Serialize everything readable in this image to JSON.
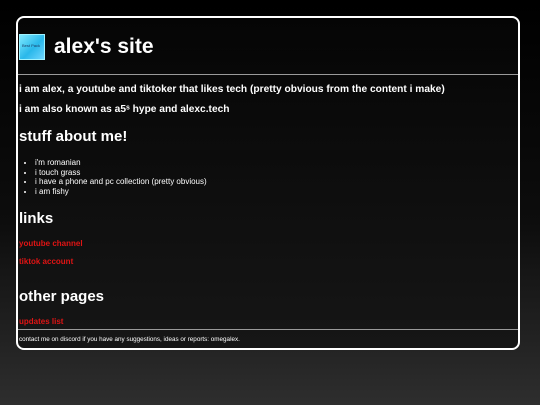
{
  "header": {
    "logo_text": "Best Pack",
    "title": "alex's site"
  },
  "intro": {
    "line1": "i am alex, a youtube and tiktoker that likes tech (pretty obvious from the content i make)",
    "line2": "i am also known as a5ˢ hype and alexc.tech"
  },
  "about": {
    "heading": "stuff about me!",
    "items": [
      "i'm romanian",
      "i touch grass",
      "i have a phone and pc collection (pretty obvious)",
      "i am fishy"
    ]
  },
  "links": {
    "heading": "links",
    "youtube": "youtube channel",
    "tiktok": "tiktok account"
  },
  "other_pages": {
    "heading": "other pages",
    "updates": "updates list"
  },
  "footer": {
    "text": "contact me on discord if you have any suggestions, ideas or reports: omegalex."
  },
  "colors": {
    "link": "#e01414",
    "border": "#ffffff",
    "background": "#000000"
  }
}
